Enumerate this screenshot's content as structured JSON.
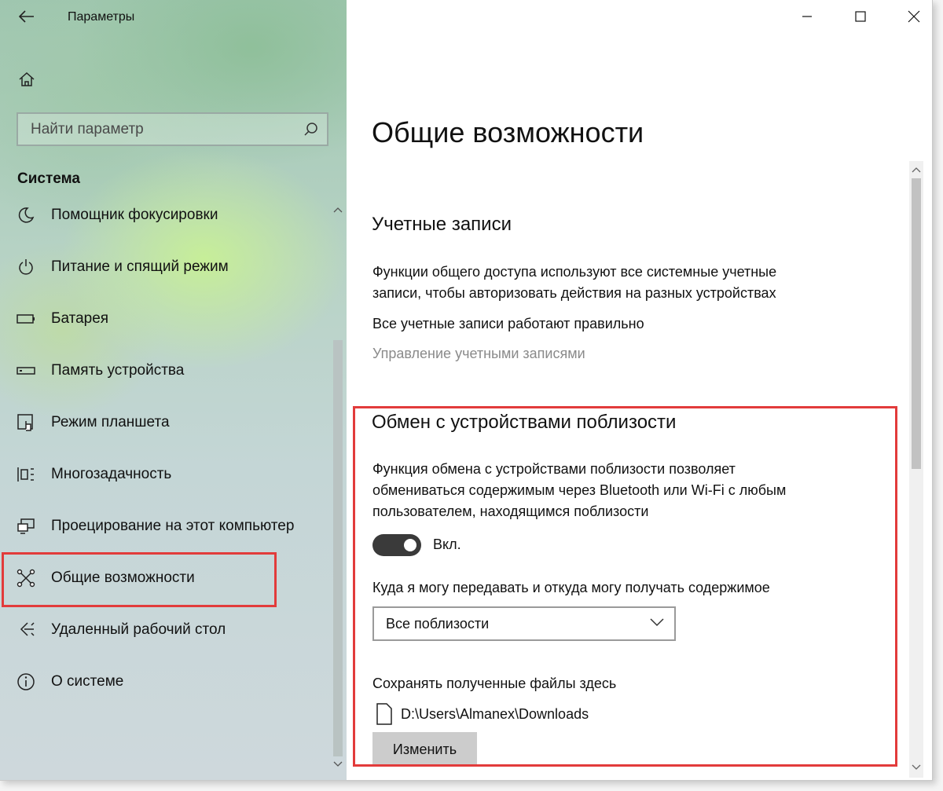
{
  "app_title": "Параметры",
  "search": {
    "placeholder": "Найти параметр"
  },
  "sidebar": {
    "section": "Система",
    "items": [
      {
        "label": "Помощник фокусировки",
        "icon": "moon-icon"
      },
      {
        "label": "Питание и спящий режим",
        "icon": "power-icon"
      },
      {
        "label": "Батарея",
        "icon": "battery-icon"
      },
      {
        "label": "Память устройства",
        "icon": "storage-icon"
      },
      {
        "label": "Режим планшета",
        "icon": "tablet-mode-icon"
      },
      {
        "label": "Многозадачность",
        "icon": "multitasking-icon"
      },
      {
        "label": "Проецирование на этот компьютер",
        "icon": "projection-icon"
      },
      {
        "label": "Общие возможности",
        "icon": "shared-experiences-icon"
      },
      {
        "label": "Удаленный рабочий стол",
        "icon": "remote-desktop-icon"
      },
      {
        "label": "О системе",
        "icon": "info-icon"
      }
    ],
    "selected": "Общие возможности"
  },
  "content": {
    "title": "Общие возможности",
    "accounts": {
      "heading": "Учетные записи",
      "desc_line1": "Функции общего доступа используют все системные учетные",
      "desc_line2": "записи, чтобы авторизовать действия на разных устройствах",
      "status": "Все учетные записи работают правильно",
      "manage_link": "Управление учетными записями"
    },
    "nearby": {
      "heading": "Обмен с устройствами поблизости",
      "desc_line1": "Функция обмена с устройствами поблизости позволяет",
      "desc_line2": "обмениваться содержимым через Bluetooth или Wi-Fi с любым",
      "desc_line3": "пользователем, находящимся поблизости",
      "toggle_state": "on",
      "toggle_label": "Вкл.",
      "share_label": "Куда я могу передавать и откуда могу получать содержимое",
      "share_value": "Все поблизости",
      "save_label": "Сохранять полученные файлы здесь",
      "save_path": "D:\\Users\\Almanex\\Downloads",
      "change_button": "Изменить"
    }
  },
  "colors": {
    "highlight": "#e23b3b",
    "toggle_on": "#3a3a3a"
  }
}
